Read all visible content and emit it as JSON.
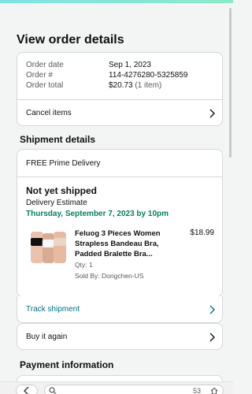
{
  "page": {
    "title": "View order details"
  },
  "summary": {
    "order_date_label": "Order date",
    "order_date": "Sep 1, 2023",
    "order_number_label": "Order #",
    "order_number": "114-4276280-5325859",
    "order_total_label": "Order total",
    "order_total": "$20.73",
    "item_count": "(1 item)",
    "cancel_label": "Cancel items"
  },
  "shipment": {
    "section_title": "Shipment details",
    "delivery_type": "FREE Prime Delivery",
    "status": "Not yet shipped",
    "estimate_label": "Delivery Estimate",
    "estimate_date": "Thursday, September 7, 2023 by 10pm",
    "product": {
      "title": "Feluog 3 Pieces Women Strapless Bandeau Bra, Padded Bralette Bra...",
      "price": "$18.99",
      "qty": "Qty: 1",
      "seller": "Sold By: Dongchen-US",
      "image_icon": "product-image"
    },
    "track_label": "Track shipment",
    "buy_again_label": "Buy it again"
  },
  "payment": {
    "section_title": "Payment information"
  },
  "browser": {
    "tab_count": "53"
  },
  "colors": {
    "accent_teal": "#007185",
    "delivery_green": "#067d62",
    "border": "#d5d9d9"
  }
}
